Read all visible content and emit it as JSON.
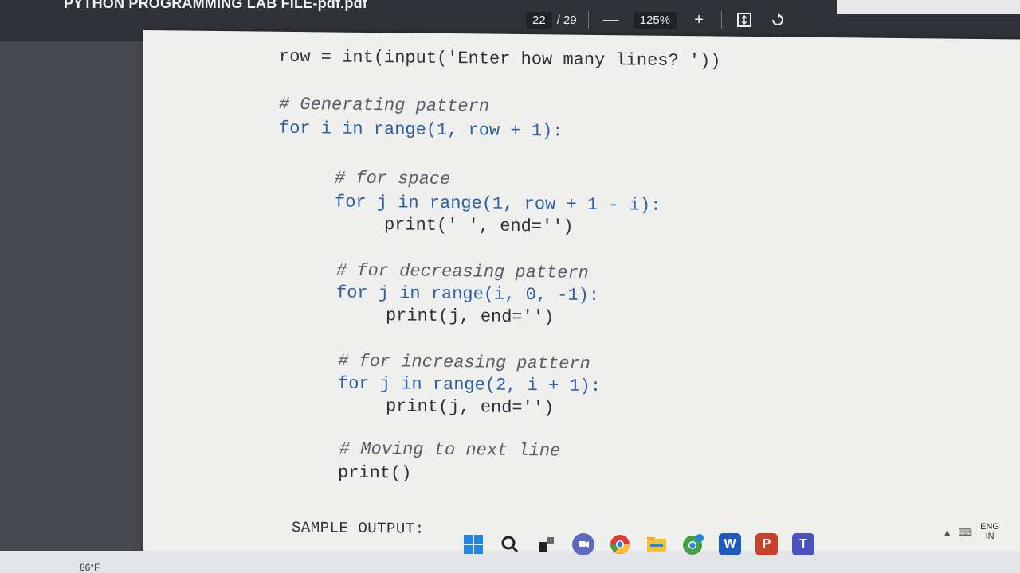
{
  "window": {
    "title": "PYTHON PROGRAMMING LAB FILE-pdf.pdf"
  },
  "toolbar": {
    "current_page": "22",
    "total_pages": "/ 29",
    "zoom_out_label": "—",
    "zoom_level": "125%",
    "zoom_in_label": "+"
  },
  "code_lines": [
    "row = int(input('Enter how many lines? '))",
    "# Generating pattern",
    "for i in range(1, row + 1):",
    "# for space",
    "for j in range(1, row + 1 - i):",
    "print(' ', end='')",
    "# for decreasing pattern",
    "for j in range(i, 0, -1):",
    "print(j, end='')",
    "# for increasing pattern",
    "for j in range(2, i + 1):",
    "print(j, end='')",
    "# Moving to next line",
    "print()"
  ],
  "sample_output_label": "SAMPLE OUTPUT:",
  "taskbar": {
    "weather": "86°F",
    "lang_top": "ENG",
    "lang_bottom": "IN",
    "apps": [
      "start-icon",
      "search-icon",
      "task-view-icon",
      "teams-chat-icon",
      "chrome-icon",
      "file-explorer-icon",
      "chrome-profile-icon",
      "word-icon",
      "powerpoint-icon",
      "teams-icon"
    ]
  }
}
